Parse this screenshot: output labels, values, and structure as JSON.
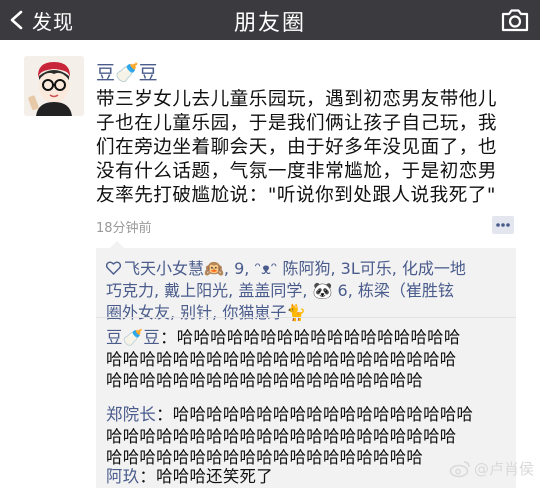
{
  "nav": {
    "back_label": "发现",
    "title": "朋友圈"
  },
  "post": {
    "author": "豆🍼豆",
    "content_lines": [
      "带三岁女儿去儿童乐园玩，遇到初恋男友带他儿",
      "子也在儿童乐园，于是我们俩让孩子自己玩，我",
      "们在旁边坐着聊会天，由于好多年没见面了，也",
      "没有什么话题，气氛一度非常尴尬，于是初恋男",
      "友率先打破尴尬说：\"听说你到处跟人说我死了\""
    ],
    "time": "18分钟前",
    "likes_lines": [
      "飞天小女慧🙉, 9, ᵔᴥᵔ 陈阿狗, 3L可乐, 化成一地",
      "巧克力, 戴上阳光, 盖盖同学, 🐼 6, 栋梁（崔胜铉",
      "圈外女友, 别针, 你猫崽子🐈"
    ],
    "comments": [
      {
        "name": "豆🍼豆",
        "lines": [
          "：哈哈哈哈哈哈哈哈哈哈哈哈哈哈哈哈哈",
          "哈哈哈哈哈哈哈哈哈哈哈哈哈哈哈哈哈哈哈哈哈",
          "哈哈哈哈哈哈哈哈哈哈哈哈哈哈哈哈哈哈哈"
        ]
      },
      {
        "name": "郑院长",
        "lines": [
          "：哈哈哈哈哈哈哈哈哈哈哈哈哈哈哈哈哈哈",
          "哈哈哈哈哈哈哈哈哈哈哈哈哈哈哈哈哈哈哈哈哈",
          "哈哈哈哈哈哈哈哈哈哈哈哈哈哈哈哈哈哈哈"
        ]
      },
      {
        "name": "阿玖",
        "lines": [
          "：哈哈哈还笑死了"
        ]
      }
    ]
  },
  "watermark": {
    "text": "@卢肖侯"
  },
  "icons": {
    "back": "chevron-left-icon",
    "camera": "camera-icon",
    "more": "comment-more-icon",
    "like": "heart-icon",
    "weibo": "weibo-logo-icon"
  },
  "colors": {
    "navbar": "#3a3a3f",
    "name_link": "#4a5c8c",
    "comment_bg": "#f2f2f2",
    "time": "#9a9a9a"
  }
}
